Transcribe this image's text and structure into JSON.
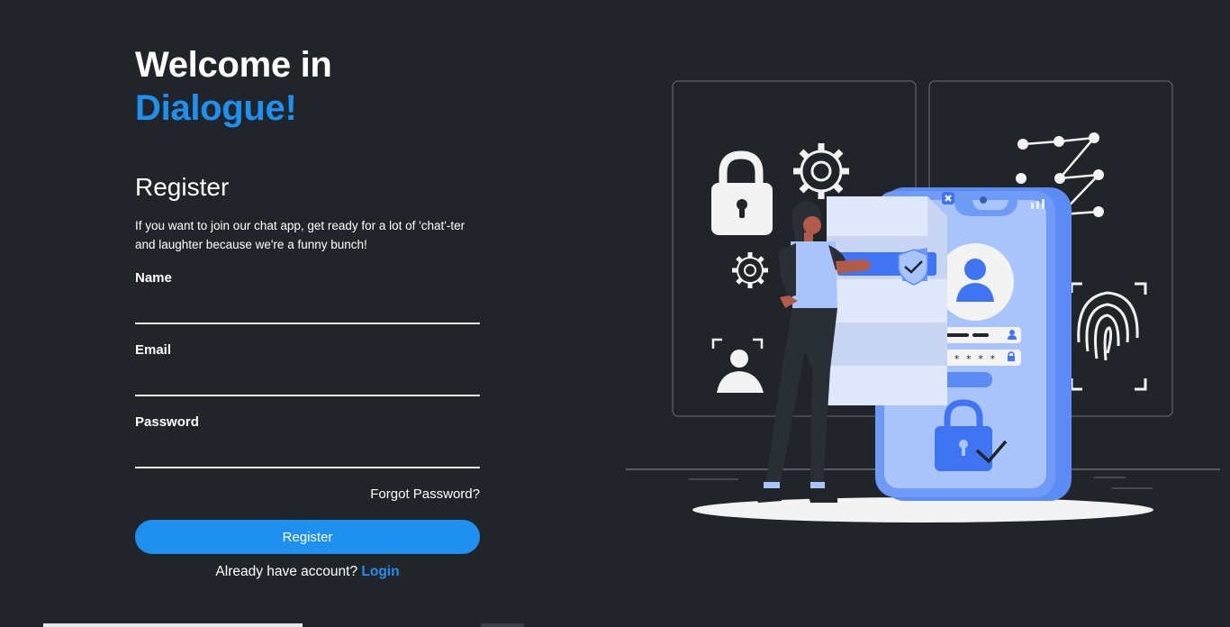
{
  "header": {
    "title_line1": "Welcome in",
    "title_line2": "Dialogue!"
  },
  "form": {
    "heading": "Register",
    "intro": "If you want to join our chat app, get ready for a lot of 'chat'-ter and laughter because we're a funny bunch!",
    "name_label": "Name",
    "email_label": "Email",
    "password_label": "Password",
    "name_value": "",
    "email_value": "",
    "password_value": "",
    "forgot_label": "Forgot Password?",
    "submit_label": "Register",
    "already_text": "Already have account?",
    "login_label": "Login"
  },
  "illustration": {
    "password_mask": "* * * * *"
  },
  "colors": {
    "background": "#212429",
    "accent": "#1e90f0",
    "phone_blue": "#5b8cf5",
    "phone_light": "#a9c3fb"
  }
}
